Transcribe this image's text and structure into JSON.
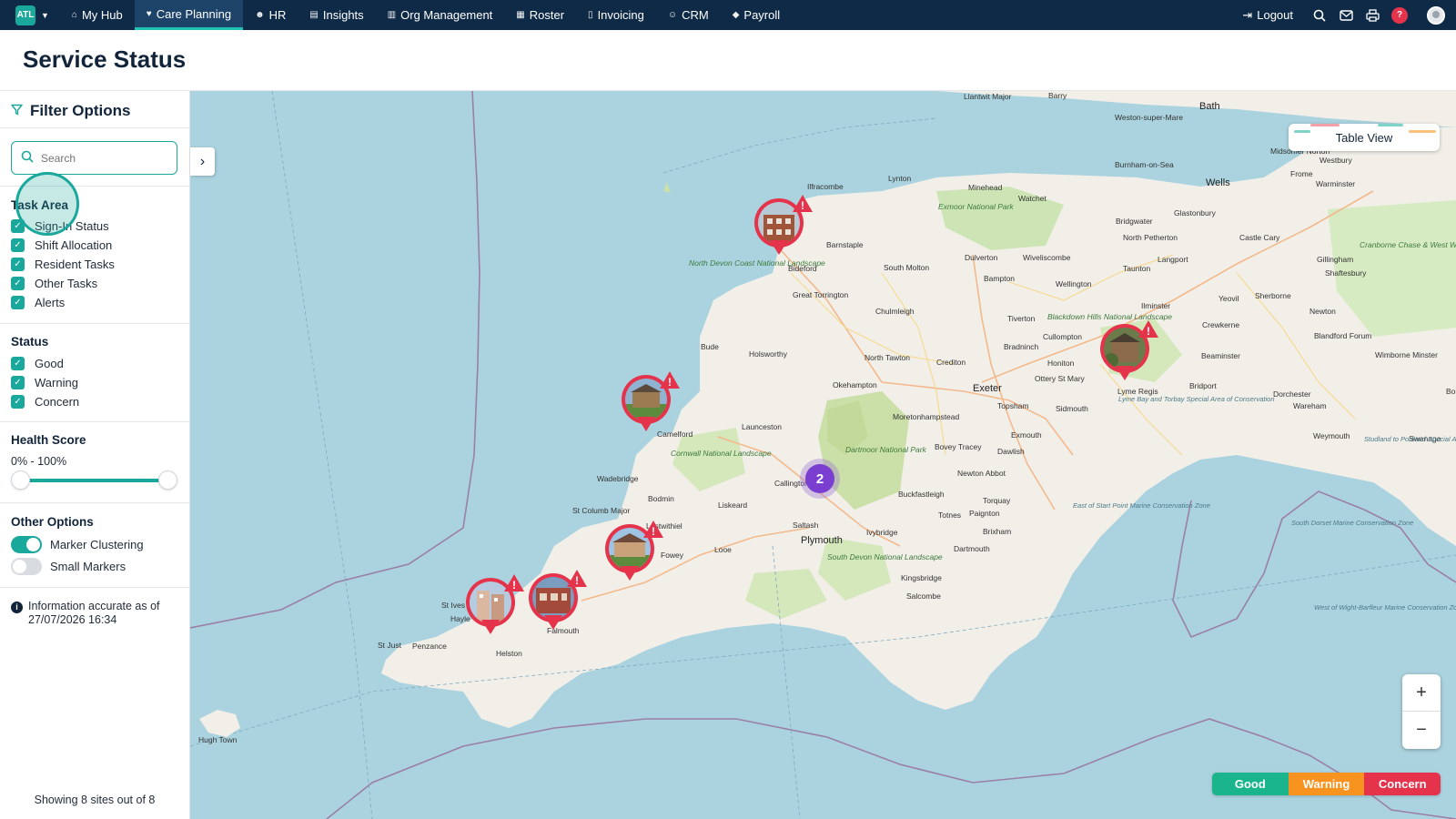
{
  "nav": {
    "logo_text": "ATL",
    "items": [
      {
        "label": "My Hub",
        "icon": "home-icon",
        "active": false
      },
      {
        "label": "Care Planning",
        "icon": "heart-icon",
        "active": true
      },
      {
        "label": "HR",
        "icon": "people-icon",
        "active": false
      },
      {
        "label": "Insights",
        "icon": "chart-icon",
        "active": false
      },
      {
        "label": "Org Management",
        "icon": "building-icon",
        "active": false
      },
      {
        "label": "Roster",
        "icon": "calendar-icon",
        "active": false
      },
      {
        "label": "Invoicing",
        "icon": "document-icon",
        "active": false
      },
      {
        "label": "CRM",
        "icon": "user-icon",
        "active": false
      },
      {
        "label": "Payroll",
        "icon": "tag-icon",
        "active": false
      }
    ],
    "logout_label": "Logout",
    "help_label": "?"
  },
  "page": {
    "title": "Service Status"
  },
  "filters": {
    "title": "Filter Options",
    "search_placeholder": "Search",
    "task_area": {
      "title": "Task Area",
      "items": [
        "Sign-In Status",
        "Shift Allocation",
        "Resident Tasks",
        "Other Tasks",
        "Alerts"
      ]
    },
    "status": {
      "title": "Status",
      "items": [
        "Good",
        "Warning",
        "Concern"
      ]
    },
    "health_score": {
      "title": "Health Score",
      "range_label": "0% - 100%",
      "min": 0,
      "max": 100
    },
    "other_options": {
      "title": "Other Options",
      "marker_clustering": {
        "label": "Marker Clustering",
        "on": true
      },
      "small_markers": {
        "label": "Small Markers",
        "on": false
      }
    },
    "info_text": "Information accurate as of 27/07/2026 16:34",
    "showing_text": "Showing 8 sites out of 8"
  },
  "map": {
    "table_view_label": "Table View",
    "zoom_in": "+",
    "zoom_out": "−",
    "cluster_count": "2",
    "legend": [
      {
        "label": "Good",
        "color": "#1ab58c"
      },
      {
        "label": "Warning",
        "color": "#f7931e"
      },
      {
        "label": "Concern",
        "color": "#e5334b"
      }
    ],
    "places": {
      "llantwit": "Llantwit Major",
      "barry": "Barry",
      "weston": "Weston-super-Mare",
      "bath": "Bath",
      "burnham": "Burnham-on-Sea",
      "wells": "Wells",
      "frome": "Frome",
      "midsomer": "Midsomer Norton",
      "westbury": "Westbury",
      "warminster": "Warminster",
      "minehead": "Minehead",
      "watchet": "Watchet",
      "lynton": "Lynton",
      "ilfracombe": "Ilfracombe",
      "bridgwater": "Bridgwater",
      "glastonbury": "Glastonbury",
      "north_petherton": "North Petherton",
      "castle_cary": "Castle Cary",
      "barnstaple": "Barnstaple",
      "south_molton": "South Molton",
      "dulverton": "Dulverton",
      "wiveliscombe": "Wiveliscombe",
      "langport": "Langport",
      "gillingham": "Gillingham",
      "shaftesbury": "Shaftesbury",
      "taunton": "Taunton",
      "bideford": "Bideford",
      "bampton": "Bampton",
      "wellington": "Wellington",
      "yeovil": "Yeovil",
      "sherborne": "Sherborne",
      "great_torrington": "Great Torrington",
      "chulmleigh": "Chulmleigh",
      "ilminster": "Ilminster",
      "crewkerne": "Crewkerne",
      "tiverton": "Tiverton",
      "cullompton": "Cullompton",
      "honiton": "Honiton",
      "beaminster": "Beaminster",
      "bude": "Bude",
      "holsworthy": "Holsworthy",
      "bradninch": "Bradninch",
      "north_tawton": "North Tawton",
      "crediton": "Crediton",
      "ottery": "Ottery St Mary",
      "bridport": "Bridport",
      "dorchester": "Dorchester",
      "lyme_regis": "Lyme Regis",
      "okehampton": "Okehampton",
      "exeter": "Exeter",
      "topsham": "Topsham",
      "sidmouth": "Sidmouth",
      "moretonhampstead": "Moretonhampstead",
      "launceston": "Launceston",
      "camelford": "Camelford",
      "exmouth": "Exmouth",
      "dawlish": "Dawlish",
      "bovey_tracey": "Bovey Tracey",
      "weymouth": "Weymouth",
      "wareham": "Wareham",
      "swanage": "Swanage",
      "newton_abbot": "Newton Abbot",
      "wadebridge": "Wadebridge",
      "callington": "Callington",
      "buckfastleigh": "Buckfastleigh",
      "torquay": "Torquay",
      "bodmin": "Bodmin",
      "liskeard": "Liskeard",
      "paignton": "Paignton",
      "totnes": "Totnes",
      "st_columb": "St Columb Major",
      "lostwithiel": "Lostwithiel",
      "saltash": "Saltash",
      "ivybridge": "Ivybridge",
      "brixham": "Brixham",
      "plymouth": "Plymouth",
      "fowey": "Fowey",
      "looe": "Looe",
      "dartmouth": "Dartmouth",
      "kingsbridge": "Kingsbridge",
      "salcombe": "Salcombe",
      "st_ives": "St Ives",
      "hayle": "Hayle",
      "falmouth": "Falmouth",
      "penzance": "Penzance",
      "st_just": "St Just",
      "helston": "Helston",
      "hugh_town": "Hugh Town",
      "blandford": "Blandford Forum",
      "wimborne": "Wimborne Minster",
      "bournemouth": "Bournemouth",
      "newton": "Newton"
    },
    "parks": {
      "exmoor": "Exmoor National Park",
      "north_devon": "North Devon Coast National Landscape",
      "blackdown": "Blackdown Hills National Landscape",
      "dartmoor": "Dartmoor National Park",
      "cornwall": "Cornwall National Landscape",
      "south_devon": "South Devon National Landscape",
      "cranborne": "Cranborne Chase & West Wiltshire Downs National Landscape"
    },
    "seas": {
      "lyme_bay": "Lyme Bay and Torbay Special Area of Conservation",
      "east_start": "East of Start Point Marine Conservation Zone",
      "south_dorset": "South Dorset Marine Conservation Zone",
      "studland": "Studland to Portland Special Area of Conservation",
      "west_wight": "West of Wight-Barfleur Marine Conservation Zone"
    }
  }
}
